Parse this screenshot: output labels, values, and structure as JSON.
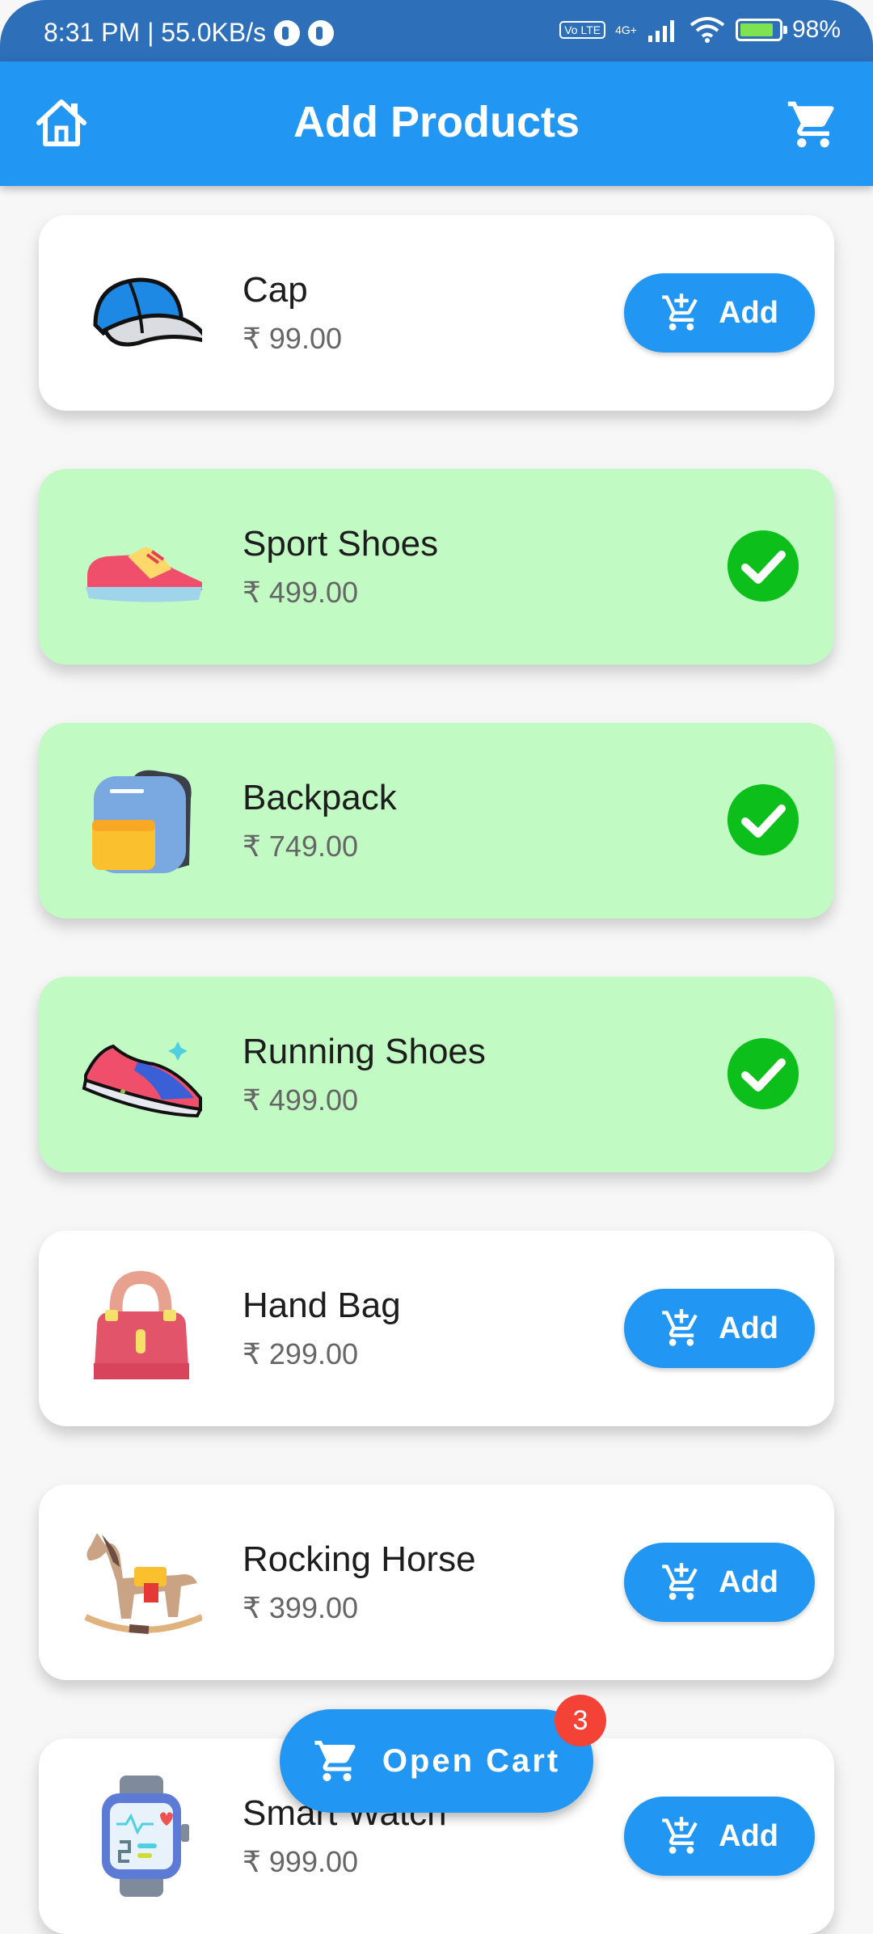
{
  "status_bar": {
    "time": "8:31 PM | 55.0KB/s",
    "network": "4G+",
    "volte": "Vo LTE",
    "battery": "98%"
  },
  "app_bar": {
    "title": "Add Products"
  },
  "products": [
    {
      "name": "Cap",
      "price": "₹ 99.00",
      "selected": false,
      "icon": "cap-icon"
    },
    {
      "name": "Sport Shoes",
      "price": "₹ 499.00",
      "selected": true,
      "icon": "sport-shoes-icon"
    },
    {
      "name": "Backpack",
      "price": "₹ 749.00",
      "selected": true,
      "icon": "backpack-icon"
    },
    {
      "name": "Running Shoes",
      "price": "₹ 499.00",
      "selected": true,
      "icon": "running-shoes-icon"
    },
    {
      "name": "Hand Bag",
      "price": "₹ 299.00",
      "selected": false,
      "icon": "hand-bag-icon"
    },
    {
      "name": "Rocking Horse",
      "price": "₹ 399.00",
      "selected": false,
      "icon": "rocking-horse-icon"
    },
    {
      "name": "Smart Watch",
      "price": "₹ 999.00",
      "selected": false,
      "icon": "smart-watch-icon"
    }
  ],
  "add_label": "Add",
  "fab": {
    "label": "Open Cart",
    "badge": "3"
  },
  "colors": {
    "primary": "#2196f3",
    "selected_bg": "#c1fbc3",
    "check": "#0dbf1a",
    "badge": "#f44336"
  }
}
